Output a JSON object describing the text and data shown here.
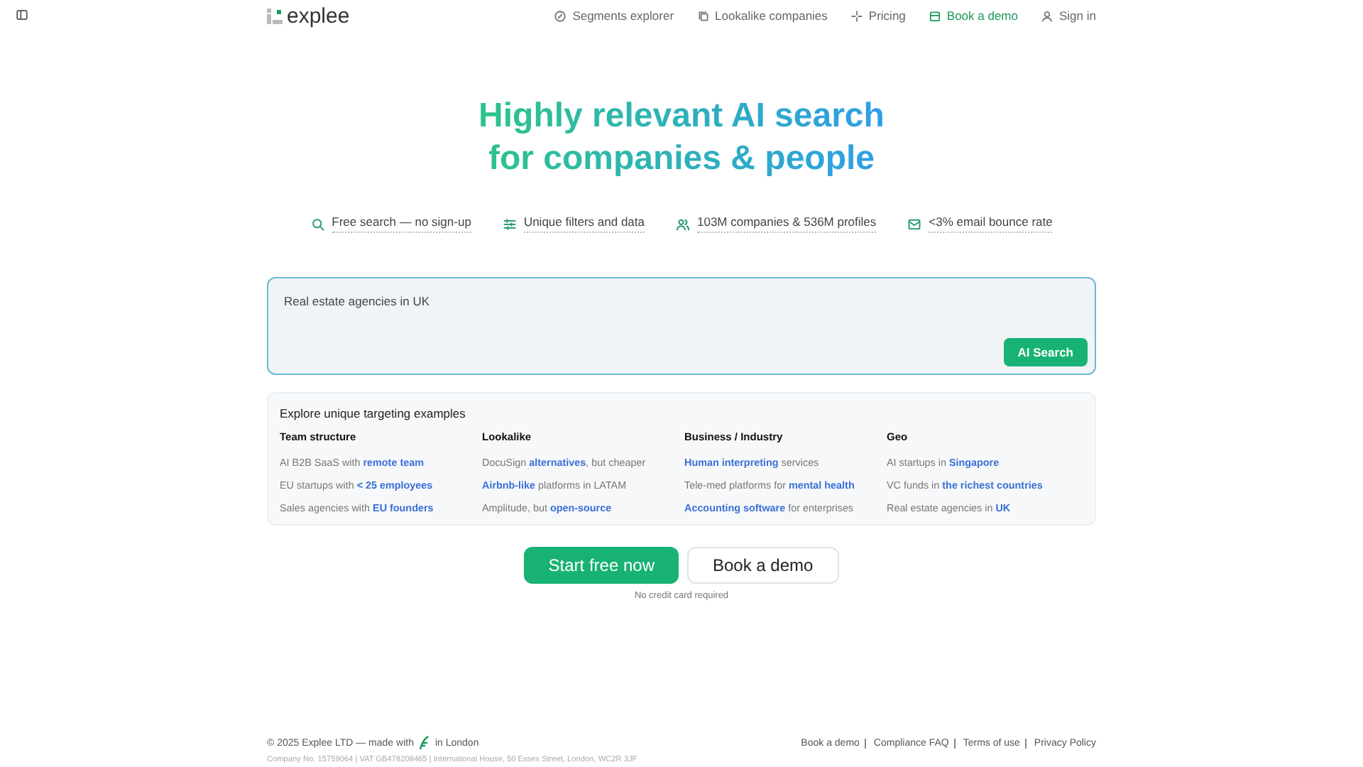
{
  "header": {
    "logo": "explee",
    "nav": [
      {
        "label": "Segments explorer",
        "kind": "segments"
      },
      {
        "label": "Lookalike companies",
        "kind": "lookalike"
      },
      {
        "label": "Pricing",
        "kind": "pricing"
      },
      {
        "label": "Book a demo",
        "kind": "demo"
      },
      {
        "label": "Sign in",
        "kind": "signin"
      }
    ]
  },
  "hero": {
    "title_lines": [
      "Highly relevant AI search",
      "for companies & people"
    ]
  },
  "features": [
    {
      "label": "Free search — no sign-up",
      "kind": "search"
    },
    {
      "label": "Unique filters and data",
      "kind": "filters"
    },
    {
      "label": "103M companies & 536M profiles",
      "kind": "people"
    },
    {
      "label": "<3% email bounce rate",
      "kind": "mail"
    }
  ],
  "search": {
    "placeholder": "Real estate agencies in UK",
    "button": "AI Search"
  },
  "examples": {
    "title": "Explore unique targeting examples",
    "columns": [
      {
        "heading": "Team structure",
        "items": [
          "AI B2B SaaS with **remote team**",
          "EU startups with **< 25 employees**",
          "Sales agencies with **EU founders**"
        ]
      },
      {
        "heading": "Lookalike",
        "items": [
          "DocuSign **alternatives**, but cheaper",
          "**Airbnb-like** platforms in LATAM",
          "Amplitude, but **open-source**"
        ]
      },
      {
        "heading": "Business / Industry",
        "items": [
          "**Human interpreting** services",
          "Tele-med platforms for **mental health**",
          "**Accounting software** for enterprises"
        ]
      },
      {
        "heading": "Geo",
        "items": [
          "AI startups in **Singapore**",
          "VC funds in **the richest countries**",
          "Real estate agencies in **UK**"
        ]
      }
    ]
  },
  "cta": {
    "primary": "Start free now",
    "secondary": "Book a demo",
    "note": "No credit card required"
  },
  "footer": {
    "copyright_before": "© 2025 Explee LTD — made with",
    "copyright_after": "in London",
    "links": [
      "Book a demo",
      "Compliance FAQ",
      "Terms of use",
      "Privacy Policy"
    ],
    "company": "Company No. 15759064 | VAT GB478208465 | International House, 50 Essex Street, London, WC2R 3JF"
  }
}
